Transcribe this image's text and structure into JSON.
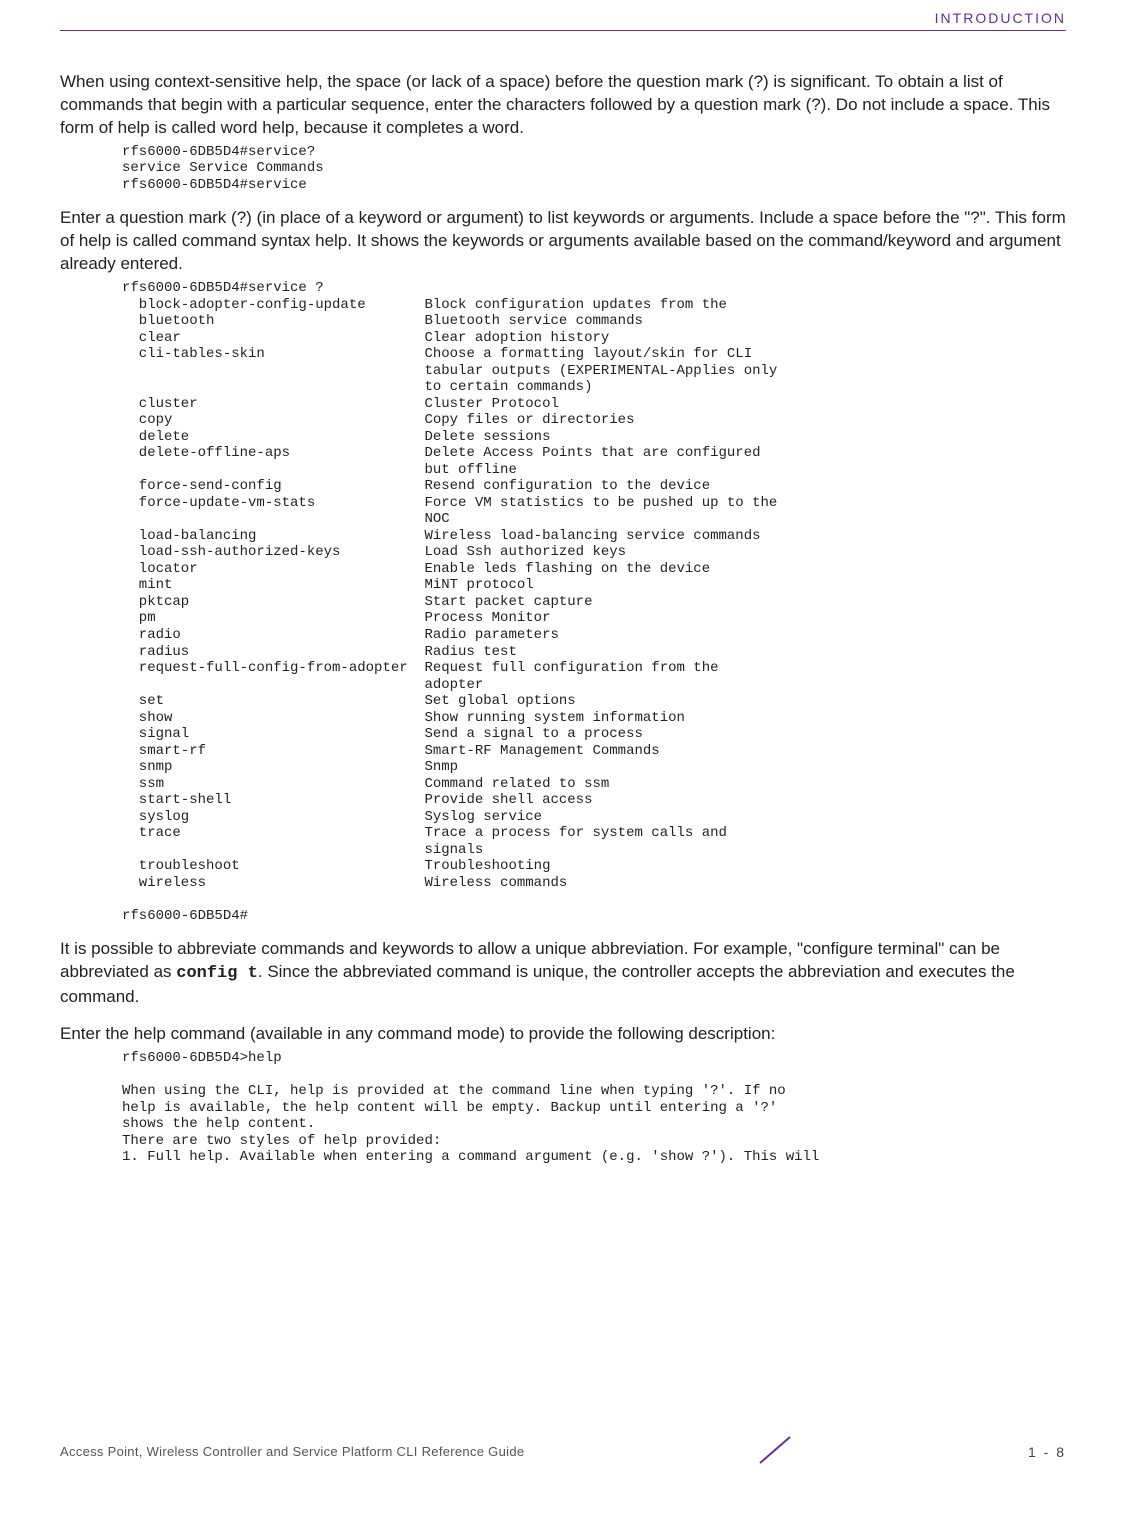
{
  "header": {
    "section": "INTRODUCTION"
  },
  "para1": "When using context-sensitive help, the space (or lack of a space) before the question mark (?) is significant. To obtain a list of commands that begin with a particular sequence, enter the characters followed by a question mark (?). Do not include a space. This form of help is called word help, because it completes a word.",
  "code1": "rfs6000-6DB5D4#service?\nservice Service Commands\nrfs6000-6DB5D4#service",
  "para2": "Enter a question mark (?) (in place of a keyword or argument) to list keywords or arguments. Include a space before the \"?\". This form of help is called command syntax help. It shows the keywords or arguments available based on the command/keyword and argument already entered.",
  "code2": "rfs6000-6DB5D4#service ?\n  block-adopter-config-update       Block configuration updates from the\n  bluetooth                         Bluetooth service commands\n  clear                             Clear adoption history\n  cli-tables-skin                   Choose a formatting layout/skin for CLI\n                                    tabular outputs (EXPERIMENTAL-Applies only\n                                    to certain commands)\n  cluster                           Cluster Protocol\n  copy                              Copy files or directories\n  delete                            Delete sessions\n  delete-offline-aps                Delete Access Points that are configured\n                                    but offline\n  force-send-config                 Resend configuration to the device\n  force-update-vm-stats             Force VM statistics to be pushed up to the\n                                    NOC\n  load-balancing                    Wireless load-balancing service commands\n  load-ssh-authorized-keys          Load Ssh authorized keys\n  locator                           Enable leds flashing on the device\n  mint                              MiNT protocol\n  pktcap                            Start packet capture\n  pm                                Process Monitor\n  radio                             Radio parameters\n  radius                            Radius test\n  request-full-config-from-adopter  Request full configuration from the\n                                    adopter\n  set                               Set global options\n  show                              Show running system information\n  signal                            Send a signal to a process\n  smart-rf                          Smart-RF Management Commands\n  snmp                              Snmp\n  ssm                               Command related to ssm\n  start-shell                       Provide shell access\n  syslog                            Syslog service\n  trace                             Trace a process for system calls and\n                                    signals\n  troubleshoot                      Troubleshooting\n  wireless                          Wireless commands\n\nrfs6000-6DB5D4#",
  "para3a": "It is possible to abbreviate commands and keywords to allow a unique abbreviation. For example, \"configure terminal\" can be abbreviated as ",
  "para3code": "config t",
  "para3b": ". Since the abbreviated command is unique, the controller accepts the abbreviation and executes the command.",
  "para4": "Enter the help command (available in any command mode) to provide the following description:",
  "code3": "rfs6000-6DB5D4>help\n\nWhen using the CLI, help is provided at the command line when typing '?'. If no\nhelp is available, the help content will be empty. Backup until entering a '?'\nshows the help content.\nThere are two styles of help provided:\n1. Full help. Available when entering a command argument (e.g. 'show ?'). This will",
  "footer": {
    "left": "Access Point, Wireless Controller and Service Platform CLI Reference Guide",
    "page": "1 - 8"
  }
}
